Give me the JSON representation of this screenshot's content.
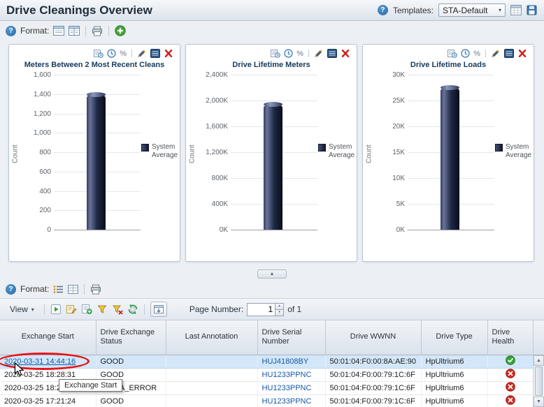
{
  "header": {
    "title": "Drive Cleanings Overview",
    "templates_label": "Templates:",
    "templates_value": "STA-Default"
  },
  "chart_format_bar": {
    "format_label": "Format:"
  },
  "table_format_bar": {
    "format_label": "Format:"
  },
  "glyphs": {
    "help": "?",
    "caret_down": "▾",
    "collapse_up": "▲",
    "scroll_up": "▲",
    "scroll_down": "▼",
    "spin_up": "▴",
    "spin_down": "▾",
    "percent": "%"
  },
  "chart_data": [
    {
      "type": "bar",
      "title": "Meters Between 2 Most Recent Cleans",
      "ylabel": "Count",
      "xlabel": "",
      "categories": [
        "System Average"
      ],
      "values": [
        1400
      ],
      "ylim": [
        0,
        1600
      ],
      "yticks": [
        "1,600",
        "1,400",
        "1,200",
        "1,000",
        "800",
        "600",
        "400",
        "200",
        "0"
      ],
      "legend": "System Average",
      "legend_position": "right",
      "grid": true
    },
    {
      "type": "bar",
      "title": "Drive Lifetime Meters",
      "ylabel": "Count",
      "xlabel": "",
      "categories": [
        "System Average"
      ],
      "values": [
        1950000
      ],
      "ylim": [
        0,
        2400000
      ],
      "yticks": [
        "2,400K",
        "2,000K",
        "1,600K",
        "1,200K",
        "800K",
        "400K",
        "0K"
      ],
      "legend": "System Average",
      "legend_position": "right",
      "grid": true
    },
    {
      "type": "bar",
      "title": "Drive Lifetime Loads",
      "ylabel": "Count",
      "xlabel": "",
      "categories": [
        "System Average"
      ],
      "values": [
        27500
      ],
      "ylim": [
        0,
        30000
      ],
      "yticks": [
        "30K",
        "25K",
        "20K",
        "15K",
        "10K",
        "5K",
        "0K"
      ],
      "legend": "System Average",
      "legend_position": "right",
      "grid": true
    }
  ],
  "table_toolbar": {
    "view_label": "View",
    "page_number_label": "Page Number:",
    "page_value": "1",
    "of_label": "of 1"
  },
  "table": {
    "columns": [
      "Exchange Start",
      "Drive Exchange Status",
      "Last Annotation",
      "Drive Serial Number",
      "Drive WWNN",
      "Drive Type",
      "Drive Health"
    ],
    "rows": [
      {
        "exchange_start": "2020-03-31 14:44:16",
        "status": "GOOD",
        "annotation": "",
        "serial": "HUJ41808BY",
        "wwnn": "50:01:04:F0:00:8A:AE:90",
        "type": "HpUltrium6",
        "health": "good",
        "selected": true,
        "link": true
      },
      {
        "exchange_start": "2020-03-25 18:28:31",
        "status": "GOOD",
        "annotation": "",
        "serial": "HU1233PPNC",
        "wwnn": "50:01:04:F0:00:79:1C:6F",
        "type": "HpUltrium6",
        "health": "bad",
        "selected": false,
        "link": false
      },
      {
        "exchange_start": "2020-03-25 18:28:31",
        "status": "MEDIA_ERROR",
        "annotation": "",
        "serial": "HU1233PPNC",
        "wwnn": "50:01:04:F0:00:79:1C:6F",
        "type": "HpUltrium6",
        "health": "bad",
        "selected": false,
        "link": false
      },
      {
        "exchange_start": "2020-03-25 17:21:24",
        "status": "GOOD",
        "annotation": "",
        "serial": "HU1233PPNC",
        "wwnn": "50:01:04:F0:00:79:1C:6F",
        "type": "HpUltrium6",
        "health": "bad",
        "selected": false,
        "link": false
      }
    ]
  },
  "tooltip": {
    "text": "Exchange Start"
  },
  "colors": {
    "bar_dark": "#10131e",
    "link": "#1558a8",
    "selected_row": "#d3e7f9",
    "health_good": "#35a435",
    "health_bad": "#cf2a21",
    "annotation_red": "#e51717"
  }
}
